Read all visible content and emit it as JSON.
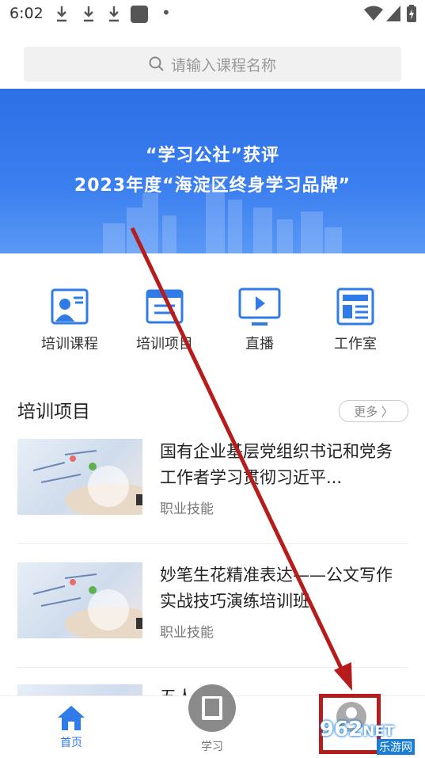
{
  "status": {
    "time": "6:02"
  },
  "search": {
    "placeholder": "请输入课程名称"
  },
  "banner": {
    "line1": "“学习公社”获评",
    "line2": "2023年度“海淀区终身学习品牌”"
  },
  "quick_links": [
    {
      "label": "培训课程",
      "icon": "course-icon"
    },
    {
      "label": "培训项目",
      "icon": "project-icon"
    },
    {
      "label": "直播",
      "icon": "live-icon"
    },
    {
      "label": "工作室",
      "icon": "studio-icon"
    }
  ],
  "section": {
    "title": "培训项目",
    "more": "更多 〉"
  },
  "courses": [
    {
      "title": "国有企业基层党组织书记和党务工作者学习贯彻习近平...",
      "tag": "职业技能"
    },
    {
      "title": "妙笔生花精准表达——公文写作实战技巧演练培训班",
      "tag": "职业技能"
    },
    {
      "title": "五人..."
    }
  ],
  "tabs": [
    {
      "label": "首页",
      "icon": "home-icon"
    },
    {
      "label": "学习",
      "icon": "book-icon"
    },
    {
      "label": "",
      "icon": "profile-icon"
    }
  ],
  "watermark": {
    "text1": "962",
    "text2": "NET",
    "text3": "乐游网"
  },
  "colors": {
    "accent": "#2f7be8",
    "annotation": "#b71c1c"
  }
}
